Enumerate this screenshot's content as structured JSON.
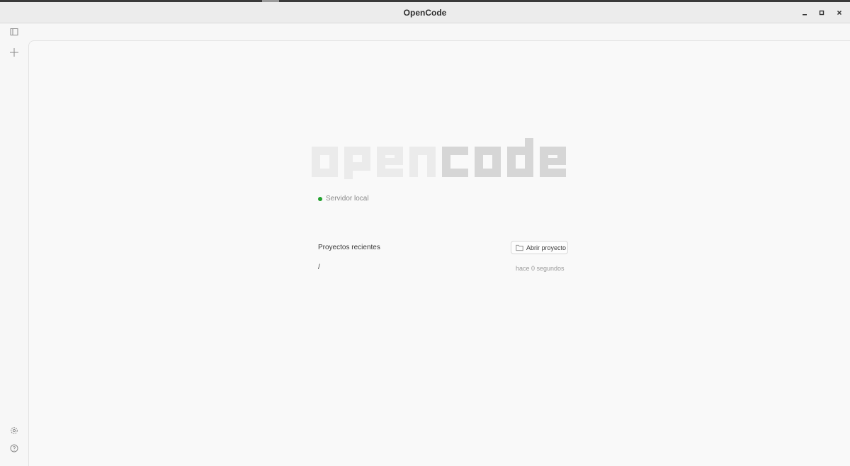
{
  "window": {
    "title": "OpenCode"
  },
  "icons": {
    "sidebar_toggle": "sidebar-panel-icon",
    "new": "plus-icon",
    "settings": "gear-icon",
    "help": "help-circle-icon",
    "folder": "folder-icon"
  },
  "logo": {
    "text_light": "open",
    "text_dark": "code"
  },
  "server": {
    "label": "Servidor local",
    "status_color": "#22a12e"
  },
  "recent": {
    "title": "Proyectos recientes",
    "open_button_label": "Abrir proyecto",
    "items": [
      {
        "path": "/",
        "time": "hace 0 segundos"
      }
    ]
  }
}
